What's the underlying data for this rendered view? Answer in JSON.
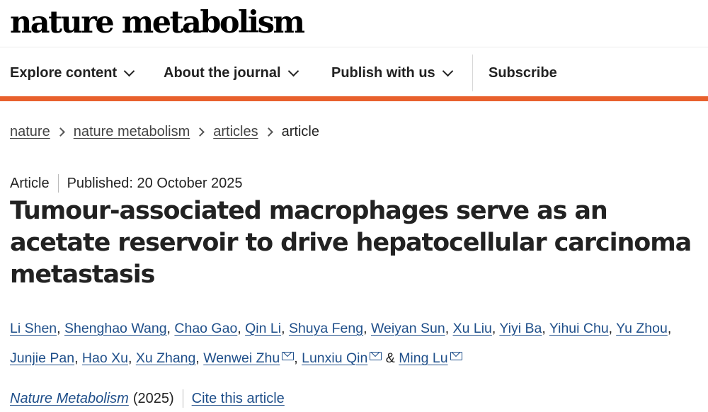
{
  "header": {
    "logo_text": "nature metabolism",
    "nav": [
      {
        "label": "Explore content",
        "icon": "chevron-down-icon"
      },
      {
        "label": "About the journal",
        "icon": "chevron-down-icon"
      },
      {
        "label": "Publish with us",
        "icon": "chevron-down-icon"
      },
      {
        "label": "Subscribe"
      }
    ],
    "accent_color": "#e8602c"
  },
  "breadcrumb": {
    "items": [
      "nature",
      "nature metabolism",
      "articles"
    ],
    "current": "article",
    "separator_icon": "chevron-right-icon"
  },
  "article": {
    "type": "Article",
    "published": "Published: 20 October 2025",
    "title": "Tumour-associated macrophages serve as an acetate reservoir to drive hepatocellular carcinoma metastasis",
    "authors": [
      "Li Shen",
      "Shenghao Wang",
      "Chao Gao",
      "Qin Li",
      "Shuya Feng",
      "Weiyan Sun",
      "Xu Liu",
      "Yiyi Ba",
      "Yihui Chu",
      "Yu Zhou",
      "Junjie Pan",
      "Hao Xu",
      "Xu Zhang",
      "Wenwei Zhu",
      "Lunxiu Qin",
      "Ming Lu"
    ],
    "separator": ",",
    "ampersand": "&",
    "corresponding_icon": "mail-icon",
    "journal": "Nature Metabolism",
    "year": "(2025)",
    "cite_label": "Cite this article",
    "link_color": "#1f4f8a"
  }
}
